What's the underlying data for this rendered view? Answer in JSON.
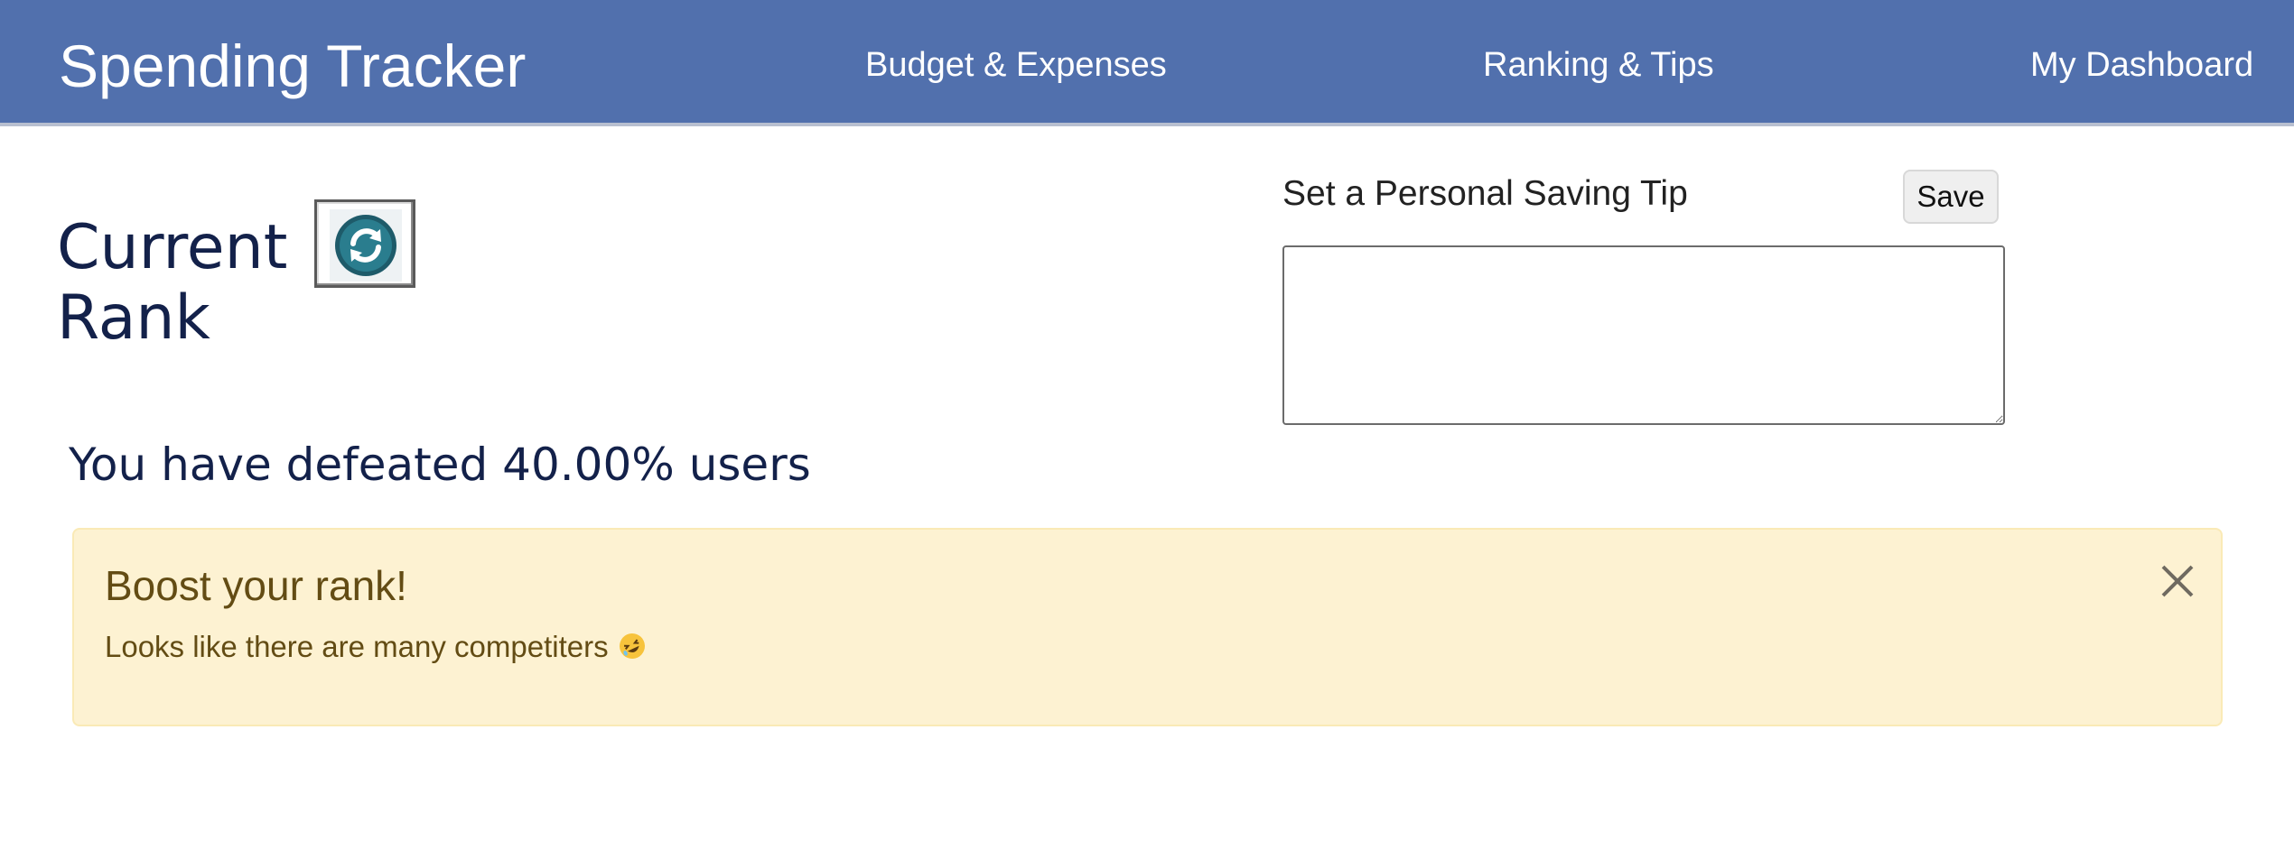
{
  "navbar": {
    "brand": "Spending Tracker",
    "links": [
      {
        "label": "Budget & Expenses"
      },
      {
        "label": "Ranking & Tips"
      },
      {
        "label": "My Dashboard"
      }
    ],
    "background": "#5170ad"
  },
  "rank": {
    "title": "Current Rank",
    "refresh_icon": "refresh-icon",
    "defeated_text": "You have defeated 40.00% users"
  },
  "tip": {
    "label": "Set a Personal Saving Tip",
    "save_label": "Save",
    "textarea_value": ""
  },
  "alert": {
    "heading": "Boost your rank!",
    "message": "Looks like there are many competiters",
    "emoji_icon": "rofl-emoji-icon",
    "close_icon": "close-icon",
    "background": "#fdf2d2",
    "text_color": "#634c14"
  }
}
